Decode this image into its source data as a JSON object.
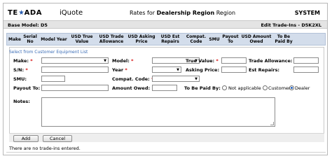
{
  "header": {
    "brand": "TEXADA",
    "app_name": "iQuote",
    "title_prefix": "Rates for ",
    "title_bold": "Dealership Region",
    "title_suffix": " Region",
    "system_label": "SYSTEM"
  },
  "infobar": {
    "base_model": "Base Model: D5",
    "edit_label": "Edit Trade-Ins - D5K2XL"
  },
  "table": {
    "columns": [
      {
        "label": "Make"
      },
      {
        "label": "Serial No"
      },
      {
        "label": "Model Year"
      },
      {
        "label": "USD True Value"
      },
      {
        "label": "USD Trade Allowance"
      },
      {
        "label": "USD Asking Price"
      },
      {
        "label": "USD Est Repairs"
      },
      {
        "label": "Compat. Code"
      },
      {
        "label": "SMU"
      },
      {
        "label": "Payout To"
      },
      {
        "label": "USD Amount Owed"
      },
      {
        "label": "To Be Paid By"
      }
    ]
  },
  "form": {
    "select_link": "Select from Customer Equipment List",
    "make_label": "Make:",
    "model_label": "Model:",
    "true_value_label": "True Value:",
    "trade_allowance_label": "Trade Allowance:",
    "sn_label": "S/N:",
    "year_label": "Year",
    "asking_price_label": "Asking Price:",
    "est_repairs_label": "Est Repairs:",
    "smu_label": "SMU:",
    "compat_code_label": "Compat. Code:",
    "payout_to_label": "Payout To:",
    "amount_owed_label": "Amount Owed:",
    "to_be_paid_by_label": "To Be Paid By:",
    "paid_by_options": [
      {
        "label": "Not applicable",
        "selected": false
      },
      {
        "label": "Customer",
        "selected": false
      },
      {
        "label": "Dealer",
        "selected": true
      }
    ],
    "notes_label": "Notes:",
    "required_marker": "*",
    "dropdown_caret": "▼"
  },
  "buttons": {
    "add": "Add",
    "cancel": "Cancel"
  },
  "status": {
    "message": "There are no trade-ins entered."
  },
  "colors": {
    "header_row": "#d3ddeb",
    "link": "#3a6cb5",
    "required": "#d40000",
    "brand_star": "#2a5db0"
  }
}
